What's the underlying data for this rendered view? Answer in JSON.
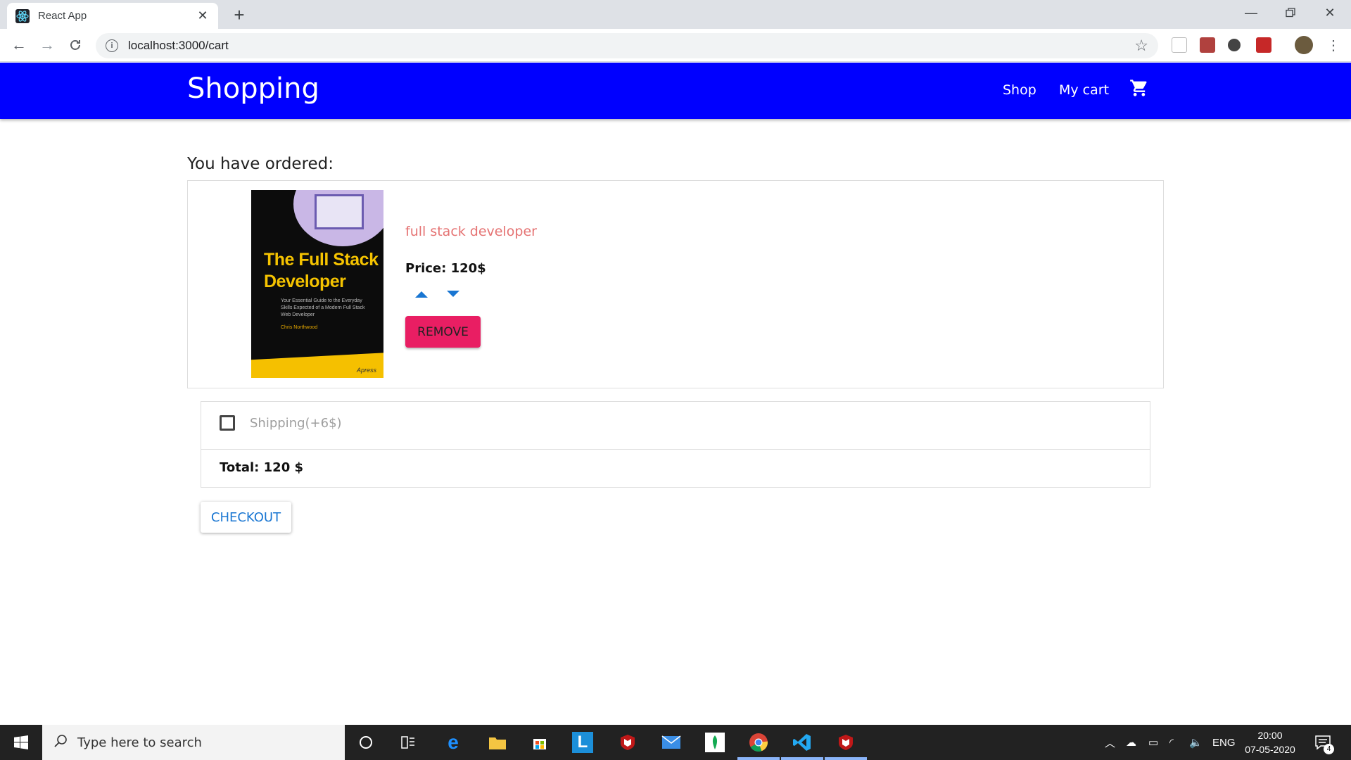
{
  "browser": {
    "tab_title": "React App",
    "url": "localhost:3000/cart"
  },
  "app": {
    "brand": "Shopping",
    "nav": {
      "shop": "Shop",
      "cart": "My cart"
    },
    "icons": {
      "cart": "shopping-cart-icon"
    }
  },
  "cart": {
    "heading": "You have ordered:",
    "item": {
      "book_cover": {
        "title_line1": "The Full Stack",
        "title_line2": "Developer",
        "subtitle": "Your Essential Guide to the Everyday Skills Expected of a Modern Full Stack Web Developer",
        "author": "Chris Northwood",
        "publisher": "Apress"
      },
      "name": "full stack developer",
      "price_label": "Price: 120$",
      "remove_label": "REMOVE"
    },
    "shipping_label": "Shipping(+6$)",
    "shipping_checked": false,
    "total_label": "Total: 120 $",
    "checkout_label": "CHECKOUT"
  },
  "colors": {
    "appbar": "#0000ff",
    "product_name": "#e57373",
    "remove_button": "#e91e63",
    "checkout_text": "#1976d2"
  },
  "taskbar": {
    "search_placeholder": "Type here to search",
    "language": "ENG",
    "time": "20:00",
    "date": "07-05-2020",
    "notification_count": "4"
  }
}
